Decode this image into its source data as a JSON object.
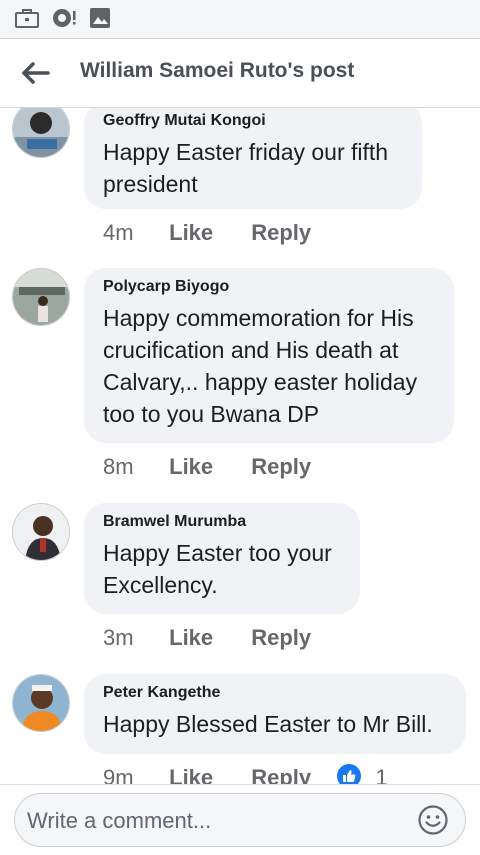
{
  "status_bar": {
    "icons": [
      "briefcase-notification-icon",
      "messenger-notification-icon",
      "photo-notification-icon"
    ]
  },
  "header": {
    "title": "William Samoei Ruto's post",
    "back_icon": "back-arrow-icon"
  },
  "comments": [
    {
      "author": "Geoffry Mutai Kongoi",
      "text": "Happy Easter friday our fifth president",
      "time": "4m",
      "like_label": "Like",
      "reply_label": "Reply"
    },
    {
      "author": "Polycarp Biyogo",
      "text": "Happy commemoration for His crucification and His death at Calvary,.. happy easter holiday too to you Bwana DP",
      "time": "8m",
      "like_label": "Like",
      "reply_label": "Reply"
    },
    {
      "author": "Bramwel Murumba",
      "text": "Happy Easter too your Excellency.",
      "time": "3m",
      "like_label": "Like",
      "reply_label": "Reply"
    },
    {
      "author": "Peter Kangethe",
      "text": "Happy Blessed Easter to Mr Bill.",
      "time": "9m",
      "like_label": "Like",
      "reply_label": "Reply",
      "reaction_icon": "like-reaction-icon",
      "reaction_count": "1"
    }
  ],
  "composer": {
    "placeholder": "Write a comment...",
    "emoji_icon": "emoji-icon"
  },
  "colors": {
    "bubble": "#f0f2f5",
    "secondary_text": "#65676b",
    "like_blue": "#1877f2"
  }
}
